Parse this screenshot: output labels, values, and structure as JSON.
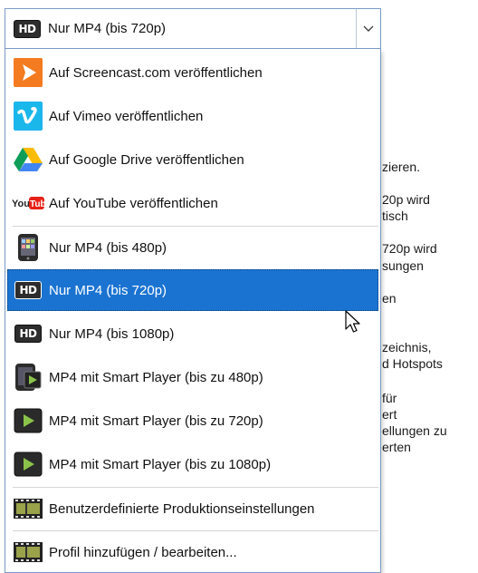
{
  "selected_profile": {
    "label": "Nur MP4 (bis 720p)",
    "icon": "hd-icon"
  },
  "dropdown_items": [
    {
      "label": "Auf Screencast.com veröffentlichen",
      "icon": "screencast-icon"
    },
    {
      "label": "Auf Vimeo veröffentlichen",
      "icon": "vimeo-icon"
    },
    {
      "label": "Auf Google Drive veröffentlichen",
      "icon": "google-drive-icon"
    },
    {
      "label": "Auf YouTube veröffentlichen",
      "icon": "youtube-icon"
    },
    {
      "label": "Nur MP4 (bis 480p)",
      "icon": "phone-icon"
    },
    {
      "label": "Nur MP4 (bis 720p)",
      "icon": "hd-icon",
      "selected": true
    },
    {
      "label": "Nur MP4 (bis 1080p)",
      "icon": "hd-icon"
    },
    {
      "label": "MP4 mit Smart Player (bis zu 480p)",
      "icon": "smart-player-phone-icon"
    },
    {
      "label": "MP4 mit Smart Player (bis zu 720p)",
      "icon": "smart-player-icon"
    },
    {
      "label": "MP4 mit Smart Player (bis zu 1080p)",
      "icon": "smart-player-icon"
    },
    {
      "label": "Benutzerdefinierte Produktionseinstellungen",
      "icon": "film-strip-icon"
    },
    {
      "label": "Profil hinzufügen / bearbeiten...",
      "icon": "film-strip-edit-icon"
    }
  ],
  "hd_badge": "HD",
  "background_text": [
    "zieren.",
    "20p wird",
    "tisch",
    "720p wird",
    "sungen",
    "en",
    "zeichnis,",
    "d Hotspots",
    "für",
    "ert",
    "ellungen zu",
    "erten"
  ],
  "colors": {
    "selection": "#1b73d1",
    "border": "#7a9cc6"
  }
}
